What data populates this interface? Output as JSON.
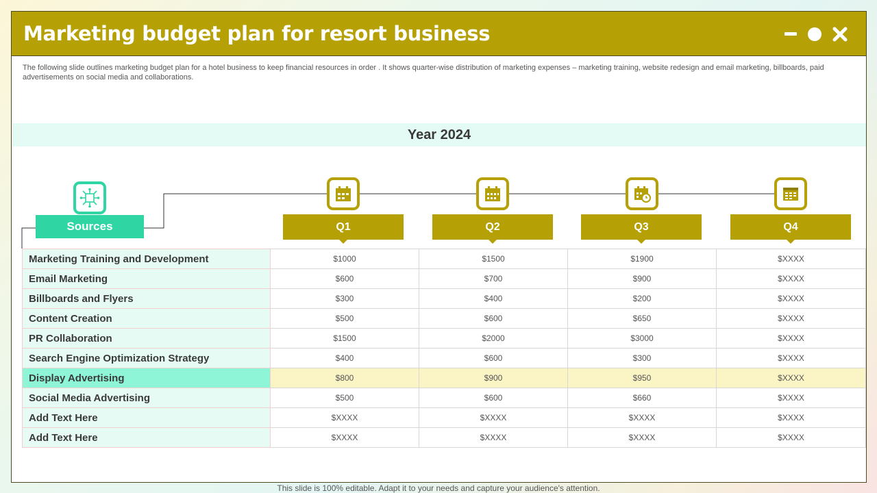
{
  "title": "Marketing budget plan for resort business",
  "window_controls": {
    "minimize": "minimize-icon",
    "maximize": "circle-icon",
    "close": "close-icon"
  },
  "description": "The following slide outlines marketing budget plan for a hotel business to keep financial resources in order . It shows quarter-wise distribution of marketing expenses – marketing training, website redesign and email marketing, billboards, paid advertisements on social media and collaborations.",
  "year_label": "Year 2024",
  "sources_label": "Sources",
  "quarters": [
    "Q1",
    "Q2",
    "Q3",
    "Q4"
  ],
  "quarter_icons": [
    "calendar-check-icon",
    "calendar-icon",
    "calendar-clock-icon",
    "calendar-grid-icon"
  ],
  "source_icon": "network-chip-icon",
  "colors": {
    "accent": "#b5a006",
    "teal": "#2fd6a4",
    "highlight_row": "#fbf4c4",
    "highlight_source": "#8ef5d6"
  },
  "rows": [
    {
      "source": "Marketing Training and Development",
      "values": [
        "$1000",
        "$1500",
        "$1900",
        "$XXXX"
      ]
    },
    {
      "source": "Email Marketing",
      "values": [
        "$600",
        "$700",
        "$900",
        "$XXXX"
      ]
    },
    {
      "source": "Billboards and Flyers",
      "values": [
        "$300",
        "$400",
        "$200",
        "$XXXX"
      ]
    },
    {
      "source": "Content Creation",
      "values": [
        "$500",
        "$600",
        "$650",
        "$XXXX"
      ]
    },
    {
      "source": "PR Collaboration",
      "values": [
        "$1500",
        "$2000",
        "$3000",
        "$XXXX"
      ]
    },
    {
      "source": "Search Engine Optimization Strategy",
      "values": [
        "$400",
        "$600",
        "$300",
        "$XXXX"
      ]
    },
    {
      "source": "Display Advertising",
      "values": [
        "$800",
        "$900",
        "$950",
        "$XXXX"
      ],
      "highlight": true
    },
    {
      "source": "Social Media Advertising",
      "values": [
        "$500",
        "$600",
        "$660",
        "$XXXX"
      ]
    },
    {
      "source": "Add Text Here",
      "values": [
        "$XXXX",
        "$XXXX",
        "$XXXX",
        "$XXXX"
      ]
    },
    {
      "source": "Add Text Here",
      "values": [
        "$XXXX",
        "$XXXX",
        "$XXXX",
        "$XXXX"
      ]
    }
  ],
  "footer": "This slide is 100% editable. Adapt it to your needs and capture your audience's attention."
}
